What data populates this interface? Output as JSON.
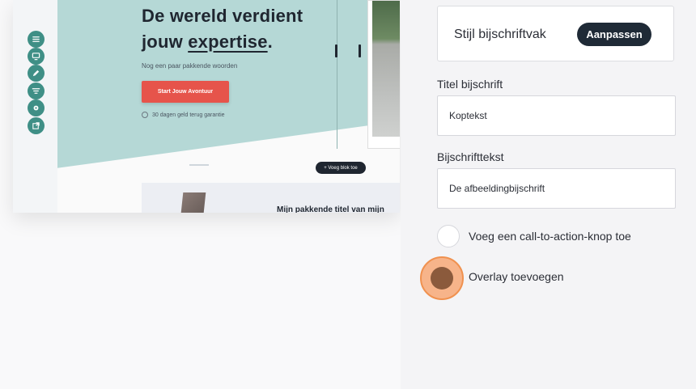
{
  "preview": {
    "hero_title_line1": "De wereld verdient",
    "hero_title_pre": "jouw ",
    "hero_title_underlined": "expertise",
    "hero_title_post": ".",
    "hero_subtitle": "Nog een paar pakkende woorden",
    "cta_label": "Start Jouw Avontuur",
    "guarantee": "30 dagen geld terug garantie",
    "add_block_label": "+ Voeg blok toe",
    "lower_title": "Mijn pakkende titel van mijn"
  },
  "toolbar": {
    "icons": [
      "menu-icon",
      "monitor-icon",
      "pencil-icon",
      "filter-icon",
      "gear-icon",
      "external-link-icon"
    ]
  },
  "panel": {
    "style_label": "Stijl bijschriftvak",
    "adjust_button": "Aanpassen",
    "caption_title_label": "Titel bijschrift",
    "caption_title_value": "Koptekst",
    "caption_text_label": "Bijschrifttekst",
    "caption_text_value": "De afbeeldingbijschrift",
    "cta_option": "Voeg een call-to-action-knop toe",
    "overlay_option": "Overlay toevoegen"
  },
  "colors": {
    "teal": "#b5d8d6",
    "tool_button": "#3f8f86",
    "cta": "#e6544b",
    "dark": "#1f2a36",
    "overlay_highlight": "#f7b48a",
    "overlay_dot": "#8b5a3c"
  }
}
